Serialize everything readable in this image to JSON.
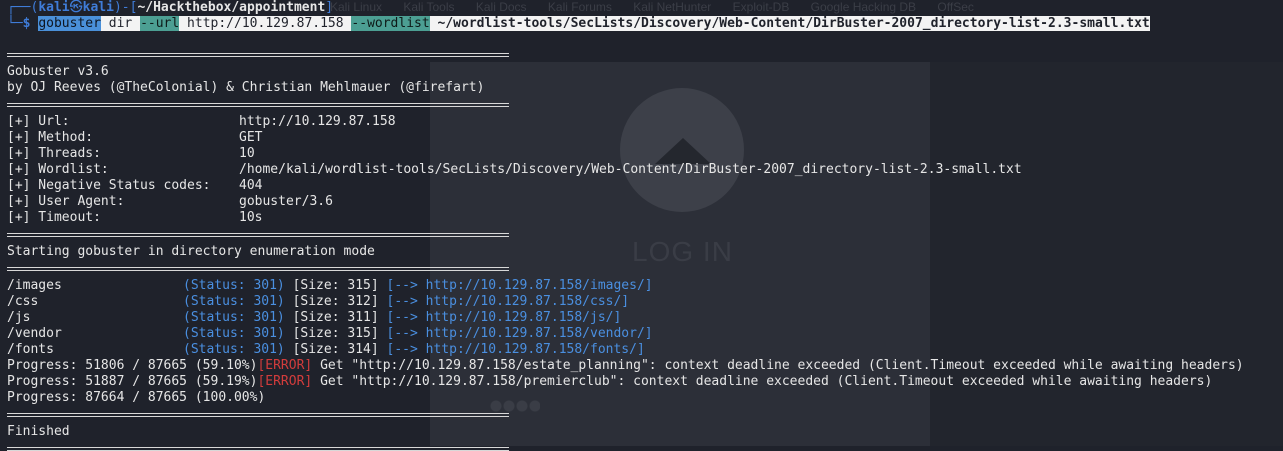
{
  "background": {
    "tabs": [
      "Kali Linux",
      "Kali Tools",
      "Kali Docs",
      "Kali Forums",
      "Kali NetHunter",
      "Exploit-DB",
      "Google Hacking DB",
      "OffSec"
    ],
    "login_text": "LOG IN"
  },
  "prompt": {
    "frame_top_left": "┌──(",
    "user": "kali",
    "at": "㉿",
    "host": "kali",
    "frame_mid": ")-[",
    "cwd": "~/Hackthebox/appointment",
    "frame_close": "]",
    "frame_bottom": "└─",
    "dollar": "$"
  },
  "command": {
    "tool": "gobuster",
    "mode": "dir",
    "url_flag": "--url",
    "url": "http://10.129.87.158",
    "wordlist_flag": "--wordlist",
    "wordlist": "~/wordlist-tools/SecLists/Discovery/Web-Content/DirBuster-2007_directory-list-2.3-small.txt"
  },
  "banner": {
    "version": "Gobuster v3.6",
    "authors": "by OJ Reeves (@TheColonial) & Christian Mehlmauer (@firefart)"
  },
  "config": [
    {
      "key": "[+] Url:",
      "value": "http://10.129.87.158"
    },
    {
      "key": "[+] Method:",
      "value": "GET"
    },
    {
      "key": "[+] Threads:",
      "value": "10"
    },
    {
      "key": "[+] Wordlist:",
      "value": "/home/kali/wordlist-tools/SecLists/Discovery/Web-Content/DirBuster-2007_directory-list-2.3-small.txt"
    },
    {
      "key": "[+] Negative Status codes:",
      "value": "404"
    },
    {
      "key": "[+] User Agent:",
      "value": "gobuster/3.6"
    },
    {
      "key": "[+] Timeout:",
      "value": "10s"
    }
  ],
  "start_message": "Starting gobuster in directory enumeration mode",
  "results": [
    {
      "path": "/images",
      "status": "(Status: 301)",
      "size": "[Size: 315]",
      "arrow": "[-->",
      "url": "http://10.129.87.158/images/]"
    },
    {
      "path": "/css",
      "status": "(Status: 301)",
      "size": "[Size: 312]",
      "arrow": "[-->",
      "url": "http://10.129.87.158/css/]"
    },
    {
      "path": "/js",
      "status": "(Status: 301)",
      "size": "[Size: 311]",
      "arrow": "[-->",
      "url": "http://10.129.87.158/js/]"
    },
    {
      "path": "/vendor",
      "status": "(Status: 301)",
      "size": "[Size: 315]",
      "arrow": "[-->",
      "url": "http://10.129.87.158/vendor/]"
    },
    {
      "path": "/fonts",
      "status": "(Status: 301)",
      "size": "[Size: 314]",
      "arrow": "[-->",
      "url": "http://10.129.87.158/fonts/]"
    }
  ],
  "progress": [
    {
      "text": "Progress: 51806 / 87665 (59.10%)",
      "error_tag": "[ERROR]",
      "message": " Get \"http://10.129.87.158/estate_planning\": context deadline exceeded (Client.Timeout exceeded while awaiting headers)"
    },
    {
      "text": "Progress: 51887 / 87665 (59.19%)",
      "error_tag": "[ERROR]",
      "message": " Get \"http://10.129.87.158/premierclub\": context deadline exceeded (Client.Timeout exceeded while awaiting headers)"
    },
    {
      "text": "Progress: 87664 / 87665 (100.00%)",
      "error_tag": "",
      "message": ""
    }
  ],
  "finished": "Finished"
}
